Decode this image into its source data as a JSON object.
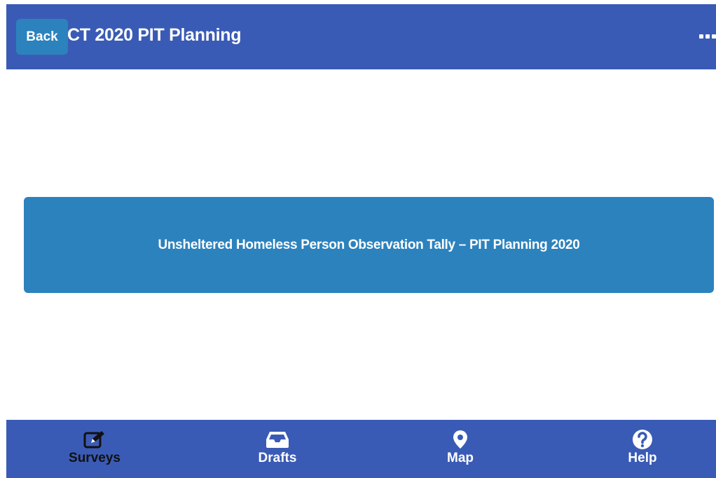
{
  "header": {
    "back_label": "Back",
    "title": "CT 2020 PIT Planning",
    "menu_icon": "more-horizontal-icon"
  },
  "main": {
    "surveys": [
      {
        "label": "Unsheltered Homeless Person Observation Tally – PIT Planning 2020"
      }
    ]
  },
  "tabbar": {
    "tabs": [
      {
        "label": "Surveys",
        "icon": "edit-icon",
        "active": true
      },
      {
        "label": "Drafts",
        "icon": "inbox-icon",
        "active": false
      },
      {
        "label": "Map",
        "icon": "map-pin-icon",
        "active": false
      },
      {
        "label": "Help",
        "icon": "help-circle-icon",
        "active": false
      }
    ]
  },
  "colors": {
    "header_bg": "#3a5bb5",
    "button_bg": "#2c82bd",
    "active_tab_text": "#111111",
    "text_on_dark": "#ffffff"
  }
}
